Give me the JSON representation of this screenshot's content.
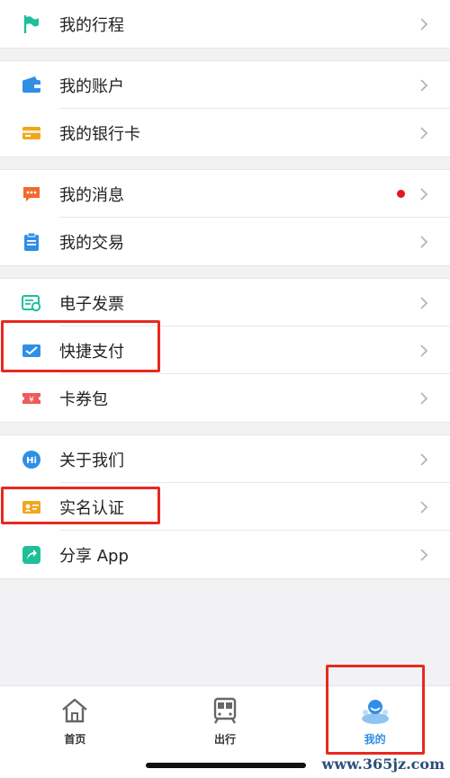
{
  "groups": [
    {
      "items": [
        {
          "label": "我的行程",
          "icon": "flag-icon"
        }
      ]
    },
    {
      "items": [
        {
          "label": "我的账户",
          "icon": "wallet-icon"
        },
        {
          "label": "我的银行卡",
          "icon": "bank-card-icon"
        }
      ]
    },
    {
      "items": [
        {
          "label": "我的消息",
          "icon": "message-icon",
          "badge": true
        },
        {
          "label": "我的交易",
          "icon": "clipboard-icon"
        }
      ]
    },
    {
      "items": [
        {
          "label": "电子发票",
          "icon": "invoice-icon"
        },
        {
          "label": "快捷支付",
          "icon": "quick-pay-icon"
        },
        {
          "label": "卡券包",
          "icon": "coupon-icon"
        }
      ]
    },
    {
      "items": [
        {
          "label": "关于我们",
          "icon": "hi-icon"
        },
        {
          "label": "实名认证",
          "icon": "id-card-icon"
        },
        {
          "label": "分享 App",
          "icon": "share-icon"
        }
      ]
    }
  ],
  "tabbar": {
    "tabs": [
      {
        "label": "首页",
        "icon": "home-icon"
      },
      {
        "label": "出行",
        "icon": "train-icon"
      },
      {
        "label": "我的",
        "icon": "profile-icon",
        "active": true
      }
    ]
  },
  "watermark": "www.365jz.com",
  "colors": {
    "accent": "#2f8fe6",
    "highlight": "#e8281f",
    "badge": "#e4161f"
  }
}
